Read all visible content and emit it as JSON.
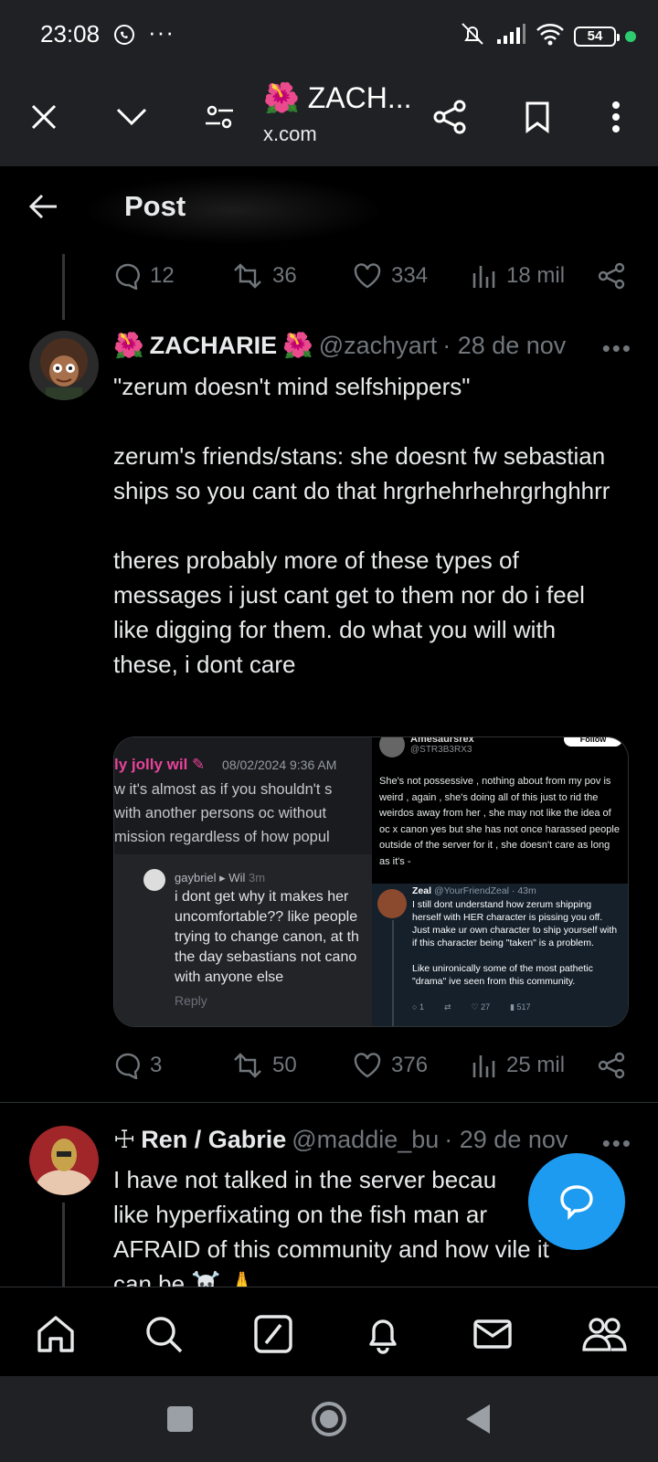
{
  "status_bar": {
    "time": "23:08",
    "battery": "54"
  },
  "browser": {
    "title": "🌺 ZACH...",
    "url": "x.com"
  },
  "header": {
    "title": "Post"
  },
  "prev_tweet_actions": {
    "replies": "12",
    "reposts": "36",
    "likes": "334",
    "views": "18 mil"
  },
  "tweet1": {
    "emoji_left": "🌺",
    "name": "ZACHARIE",
    "emoji_right": "🌺",
    "handle": "@zachyart",
    "date": "· 28 de nov",
    "text": "\"zerum doesn't mind selfshippers\"\n\nzerum's friends/stans: she doesnt fw sebastian ships so you cant do that hrgrhehrhehrgrhghhrr\n\ntheres probably more of these types of messages i just cant get to them nor do i feel like digging for them. do what you will with these, i dont care",
    "actions": {
      "replies": "3",
      "reposts": "50",
      "likes": "376",
      "views": "25 mil"
    },
    "media_left": {
      "author": "ly jolly wil",
      "timestamp": "08/02/2024 9:36 AM",
      "message": "w it's almost as if you shouldn't s\nwith another persons oc without\nmission regardless of how popul",
      "reply_author": "gaybriel",
      "reply_to": "▸ Wil",
      "reply_time": "3m",
      "reply_text": "i dont get why it makes her\nuncomfortable?? like people\ntrying to change canon, at th\nthe day sebastians not cano\nwith anyone else",
      "reply_label": "Reply"
    },
    "media_right": {
      "top_name": "Amesaursrex",
      "top_handle": "@STR3B3RX3",
      "top_follow": "Follow",
      "top_text": "She's not possessive , nothing about from my pov is weird , again , she's doing all of this just to rid the weirdos away from her , she may not like the idea of oc x canon yes but she has not once harassed people outside of the server for it , she doesn't care as long as it's -",
      "reply_name": "Zeal",
      "reply_handle": "@YourFriendZeal · 43m",
      "reply_text": "I still dont understand how zerum shipping herself with HER character is pissing you off. Just make ur own character to ship yourself with if this character being \"taken\" is a problem.\n\nLike unironically some of the most pathetic \"drama\" ive seen from this community.",
      "reply_stats": {
        "replies": "1",
        "likes": "27",
        "views": "517"
      }
    }
  },
  "tweet2": {
    "icon": "☩",
    "name": "Ren / Gabrie",
    "handle": "@maddie_bu",
    "date": "· 29 de nov",
    "text": "I have not talked in the server becau\nlike hyperfixating on the fish man ar\nAFRAID of this community and how vile it\ncan be ☠️ 🙏"
  },
  "colors": {
    "accent": "#1d9bf0",
    "background": "#000000",
    "muted": "#71767b",
    "browser_bar": "#202124"
  }
}
